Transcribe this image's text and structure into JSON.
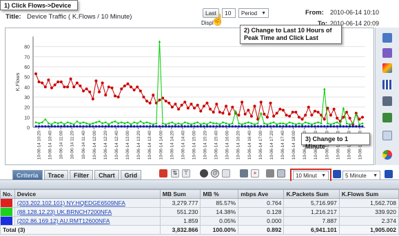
{
  "callouts": {
    "step1": "1) Click Flows->Device",
    "step2": "2) Change to Last 10 Hours of Peak Time and Click Last",
    "step3": "3) Change to 1 Minute"
  },
  "header": {
    "title_label": "Title:",
    "title_value": "Device Traffic ( K.Flows / 10 Minute)",
    "last_button": "Last",
    "last_count": "10",
    "period_select": "Period",
    "display_label": "Displ",
    "from_label": "From:",
    "from_value": "2010-06-14 10:10",
    "to_label": "To:",
    "to_value": "2010-06-14 20:09"
  },
  "chart_data": {
    "type": "line",
    "ylabel": "K.Flows",
    "ylim": [
      0,
      90
    ],
    "yticks": [
      0,
      10,
      20,
      30,
      40,
      50,
      60,
      70,
      80
    ],
    "categories": [
      "10-06-14 10:20",
      "10-06-14 10:40",
      "10-06-14 11:00",
      "10-06-14 11:20",
      "10-06-14 11:40",
      "10-06-14 12:00",
      "10-06-14 12:20",
      "10-06-14 12:40",
      "10-06-14 13:00",
      "10-06-14 13:20",
      "10-06-14 13:40",
      "10-06-14 14:00",
      "10-06-14 14:20",
      "10-06-14 14:40",
      "10-06-14 15:00",
      "10-06-14 15:20",
      "10-06-14 15:40",
      "10-06-14 16:00",
      "10-06-14 16:20",
      "10-06-14 16:40",
      "10-06-14 17:00",
      "10-06-14 17:20",
      "10-06-14 17:40",
      "10-06-14 18:00",
      "10-06-14 18:20",
      "10-06-14 18:40",
      "10-06-14 19:00",
      "10-06-14 19:20",
      "10-06-14 19:40",
      "10-06-14 20:00"
    ],
    "grid": true,
    "series": [
      {
        "name": "NY.HQEDGE6509NFA",
        "color": "#cc0000",
        "values": [
          53,
          45,
          44,
          40,
          47,
          39,
          42,
          45,
          45,
          40,
          40,
          48,
          40,
          44,
          41,
          36,
          38,
          35,
          28,
          46,
          35,
          44,
          32,
          40,
          39,
          31,
          30,
          38,
          41,
          43,
          40,
          37,
          40,
          36,
          30,
          26,
          24,
          32,
          24,
          27,
          29,
          26,
          24,
          20,
          23,
          18,
          22,
          25,
          19,
          23,
          19,
          22,
          16,
          21,
          24,
          18,
          15,
          23,
          15,
          14,
          21,
          13,
          20,
          14,
          12,
          25,
          13,
          17,
          11,
          21,
          8,
          25,
          13,
          10,
          24,
          11,
          14,
          18,
          17,
          12,
          11,
          15,
          15,
          10,
          8,
          12,
          20,
          12,
          16,
          15,
          12,
          8,
          19,
          12,
          18,
          9,
          6,
          10,
          15,
          9,
          3,
          14,
          8,
          10
        ]
      },
      {
        "name": "UK.BRNCH7200NFA",
        "color": "#00cc00",
        "values": [
          5,
          4,
          5,
          8,
          4,
          3,
          5,
          4,
          5,
          3,
          5,
          4,
          3,
          6,
          4,
          5,
          4,
          3,
          4,
          5,
          6,
          4,
          5,
          3,
          5,
          6,
          4,
          5,
          4,
          5,
          3,
          5,
          4,
          6,
          4,
          5,
          4,
          3,
          4,
          85,
          4,
          3,
          4,
          5,
          3,
          4,
          3,
          5,
          4,
          3,
          4,
          5,
          3,
          4,
          3,
          5,
          4,
          4,
          3,
          5,
          4,
          3,
          4,
          16,
          4,
          3,
          4,
          5,
          4,
          3,
          4,
          14,
          4,
          3,
          4,
          5,
          3,
          4,
          4,
          3,
          5,
          4,
          3,
          4,
          3,
          5,
          4,
          3,
          4,
          5,
          4,
          38,
          4,
          3,
          4,
          5,
          3,
          19,
          4,
          3,
          4,
          13,
          3,
          4
        ]
      },
      {
        "name": "AU.RMT12600NFA",
        "color": "#0000cc",
        "values": [
          1,
          1,
          1,
          1,
          1,
          1,
          1,
          1,
          1,
          1,
          1,
          1,
          1,
          1,
          1,
          1,
          1,
          1,
          1,
          1,
          1,
          1,
          1,
          1,
          1,
          1,
          1,
          1,
          1,
          1,
          1,
          1,
          1,
          1,
          1,
          1,
          1,
          1,
          1,
          1,
          1,
          1,
          1,
          1,
          1,
          1,
          1,
          1,
          1,
          1,
          1,
          1,
          1,
          1,
          1,
          1,
          1,
          1,
          1,
          1,
          1,
          1,
          1,
          1,
          1,
          1,
          1,
          1,
          1,
          1,
          1,
          1,
          1,
          1,
          1,
          1,
          1,
          1,
          1,
          1,
          1,
          1,
          1,
          1,
          1,
          1,
          1,
          1,
          1,
          1,
          1,
          1,
          1,
          1,
          1,
          1,
          1,
          1,
          1,
          1,
          1,
          1,
          1,
          1
        ]
      }
    ]
  },
  "tabs": [
    "Criteria",
    "Trace",
    "Filter",
    "Chart",
    "Grid"
  ],
  "toolbar": {
    "interval_select": "10 Minut",
    "period_select2": "5 Minute"
  },
  "table": {
    "headers": [
      "No.",
      "Device",
      "MB Sum",
      "MB %",
      "mbps Ave",
      "K.Packets Sum",
      "K.Flows Sum"
    ],
    "rows": [
      {
        "color": "#e0201c",
        "device": "(203.202.102.101) NY.HQEDGE6509NFA",
        "mb_sum": "3,279.777",
        "mb_pct": "85.57%",
        "mbps": "0.764",
        "kpackets": "5,716.997",
        "kflows": "1,562.708"
      },
      {
        "color": "#1fd11f",
        "device": "(88.128.12.23) UK.BRNCH7200NFA",
        "mb_sum": "551.230",
        "mb_pct": "14.38%",
        "mbps": "0.128",
        "kpackets": "1,216.217",
        "kflows": "339.920"
      },
      {
        "color": "#1a2ee0",
        "device": "(202.86.169.12) AU.RMT12600NFA",
        "mb_sum": "1.859",
        "mb_pct": "0.05%",
        "mbps": "0.000",
        "kpackets": "7.887",
        "kflows": "2.374"
      }
    ],
    "total": {
      "label": "Total (3)",
      "mb_sum": "3,832.866",
      "mb_pct": "100.00%",
      "mbps": "0.892",
      "kpackets": "6,941.101",
      "kflows": "1,905.002"
    }
  }
}
